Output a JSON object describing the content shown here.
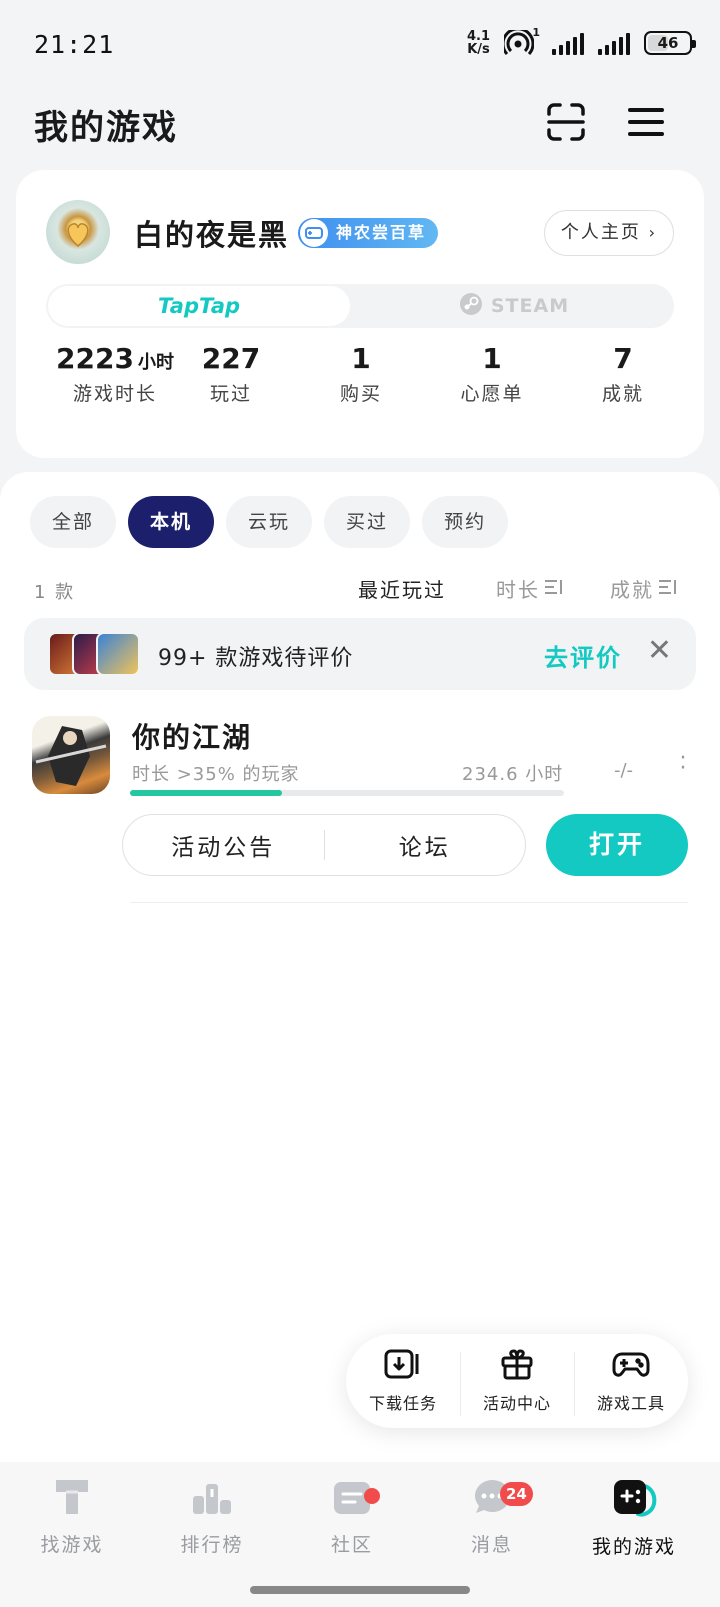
{
  "status_bar": {
    "time": "21:21",
    "net_speed_value": "4.1",
    "net_speed_unit": "K/s",
    "hotspot_sup": "1",
    "battery": "46"
  },
  "header": {
    "title": "我的游戏"
  },
  "profile": {
    "username": "白的夜是黑",
    "badge": "神农尝百草",
    "home_button": "个人主页",
    "platforms": {
      "taptap": "TapTap",
      "steam": "STEAM",
      "selected": "taptap"
    },
    "stats": [
      {
        "value": "2223",
        "unit": "小时",
        "label": "游戏时长"
      },
      {
        "value": "227",
        "label": "玩过"
      },
      {
        "value": "1",
        "label": "购买"
      },
      {
        "value": "1",
        "label": "心愿单"
      },
      {
        "value": "7",
        "label": "成就"
      }
    ]
  },
  "filters": {
    "items": [
      "全部",
      "本机",
      "云玩",
      "买过",
      "预约"
    ],
    "active": "本机"
  },
  "list": {
    "count": "1 款",
    "sort": {
      "recent": "最近玩过",
      "duration": "时长",
      "achievement": "成就"
    }
  },
  "review_banner": {
    "text": "99+ 款游戏待评价",
    "action": "去评价"
  },
  "game": {
    "name": "你的江湖",
    "subtitle": "时长 >35% 的玩家",
    "hours": "234.6 小时",
    "extra": "-/-",
    "progress": 0.35,
    "actions": [
      "活动公告",
      "论坛"
    ],
    "open": "打开"
  },
  "floating_tools": [
    {
      "icon": "download-icon",
      "label": "下载任务"
    },
    {
      "icon": "gift-icon",
      "label": "活动中心"
    },
    {
      "icon": "gamepad-icon",
      "label": "游戏工具"
    }
  ],
  "bottom_nav": [
    {
      "icon": "find-games-icon",
      "label": "找游戏"
    },
    {
      "icon": "ranking-icon",
      "label": "排行榜"
    },
    {
      "icon": "community-icon",
      "label": "社区"
    },
    {
      "icon": "messages-icon",
      "label": "消息",
      "badge": "24"
    },
    {
      "icon": "my-games-icon",
      "label": "我的游戏",
      "active": true
    }
  ],
  "colors": {
    "accent": "#14c9c2",
    "active_chip": "#1c1f6b",
    "badge_red": "#f24b4b",
    "progress": "#23c7a0"
  }
}
